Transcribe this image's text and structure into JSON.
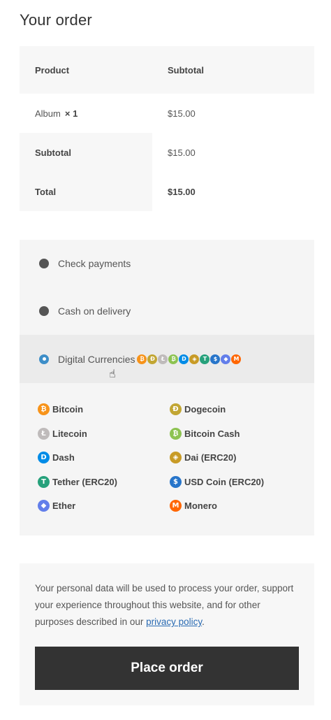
{
  "title": "Your order",
  "table": {
    "header": {
      "product": "Product",
      "subtotal": "Subtotal"
    },
    "item": {
      "name": "Album",
      "qty": "× 1",
      "price": "$15.00"
    },
    "subtotal": {
      "label": "Subtotal",
      "value": "$15.00"
    },
    "total": {
      "label": "Total",
      "value": "$15.00"
    }
  },
  "payment": {
    "methods": [
      {
        "label": "Check payments",
        "selected": false
      },
      {
        "label": "Cash on delivery",
        "selected": false
      },
      {
        "label": "Digital Currencies",
        "selected": true
      }
    ],
    "coins": [
      {
        "name": "Bitcoin",
        "symbol": "₿",
        "color": "#f7931a"
      },
      {
        "name": "Dogecoin",
        "symbol": "Đ",
        "color": "#c2a633"
      },
      {
        "name": "Litecoin",
        "symbol": "Ł",
        "color": "#bfbbbb"
      },
      {
        "name": "Bitcoin Cash",
        "symbol": "₿",
        "color": "#8dc351"
      },
      {
        "name": "Dash",
        "symbol": "D",
        "color": "#008ce7"
      },
      {
        "name": "Dai (ERC20)",
        "symbol": "◈",
        "color": "#c89b26"
      },
      {
        "name": "Tether (ERC20)",
        "symbol": "T",
        "color": "#26a17b"
      },
      {
        "name": "USD Coin (ERC20)",
        "symbol": "$",
        "color": "#2775ca"
      },
      {
        "name": "Ether",
        "symbol": "◆",
        "color": "#627eea"
      },
      {
        "name": "Monero",
        "symbol": "M",
        "color": "#ff6600"
      }
    ]
  },
  "privacy": {
    "text_before": "Your personal data will be used to process your order, support your experience throughout this website, and for other purposes described in our ",
    "link": "privacy policy",
    "text_after": "."
  },
  "place_order_label": "Place order"
}
